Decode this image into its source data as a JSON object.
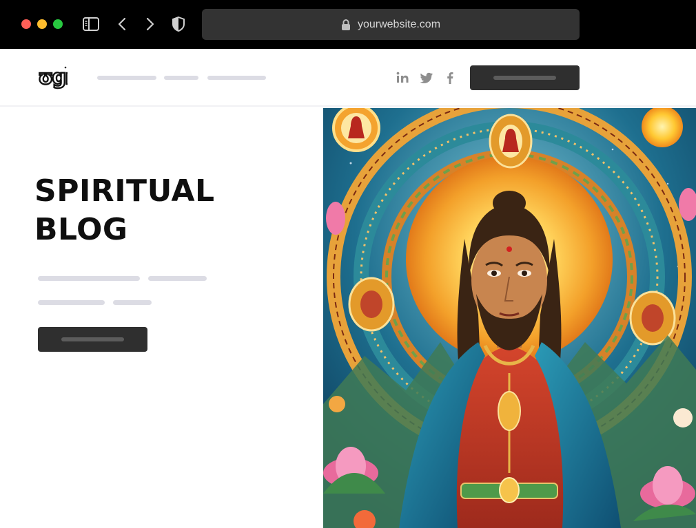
{
  "browser": {
    "url": "yourwebsite.com",
    "colors": {
      "chrome": "#000000",
      "close": "#ff5f57",
      "minimize": "#febc2e",
      "zoom": "#28c840"
    }
  },
  "header": {
    "logo_text": "ʊgn",
    "social_icons": [
      "linkedin-icon",
      "twitter-icon",
      "facebook-icon"
    ]
  },
  "hero": {
    "title_line1": "SPIRITUAL",
    "title_line2": "BLOG",
    "image_subject": "spiritual-figure-painting"
  }
}
